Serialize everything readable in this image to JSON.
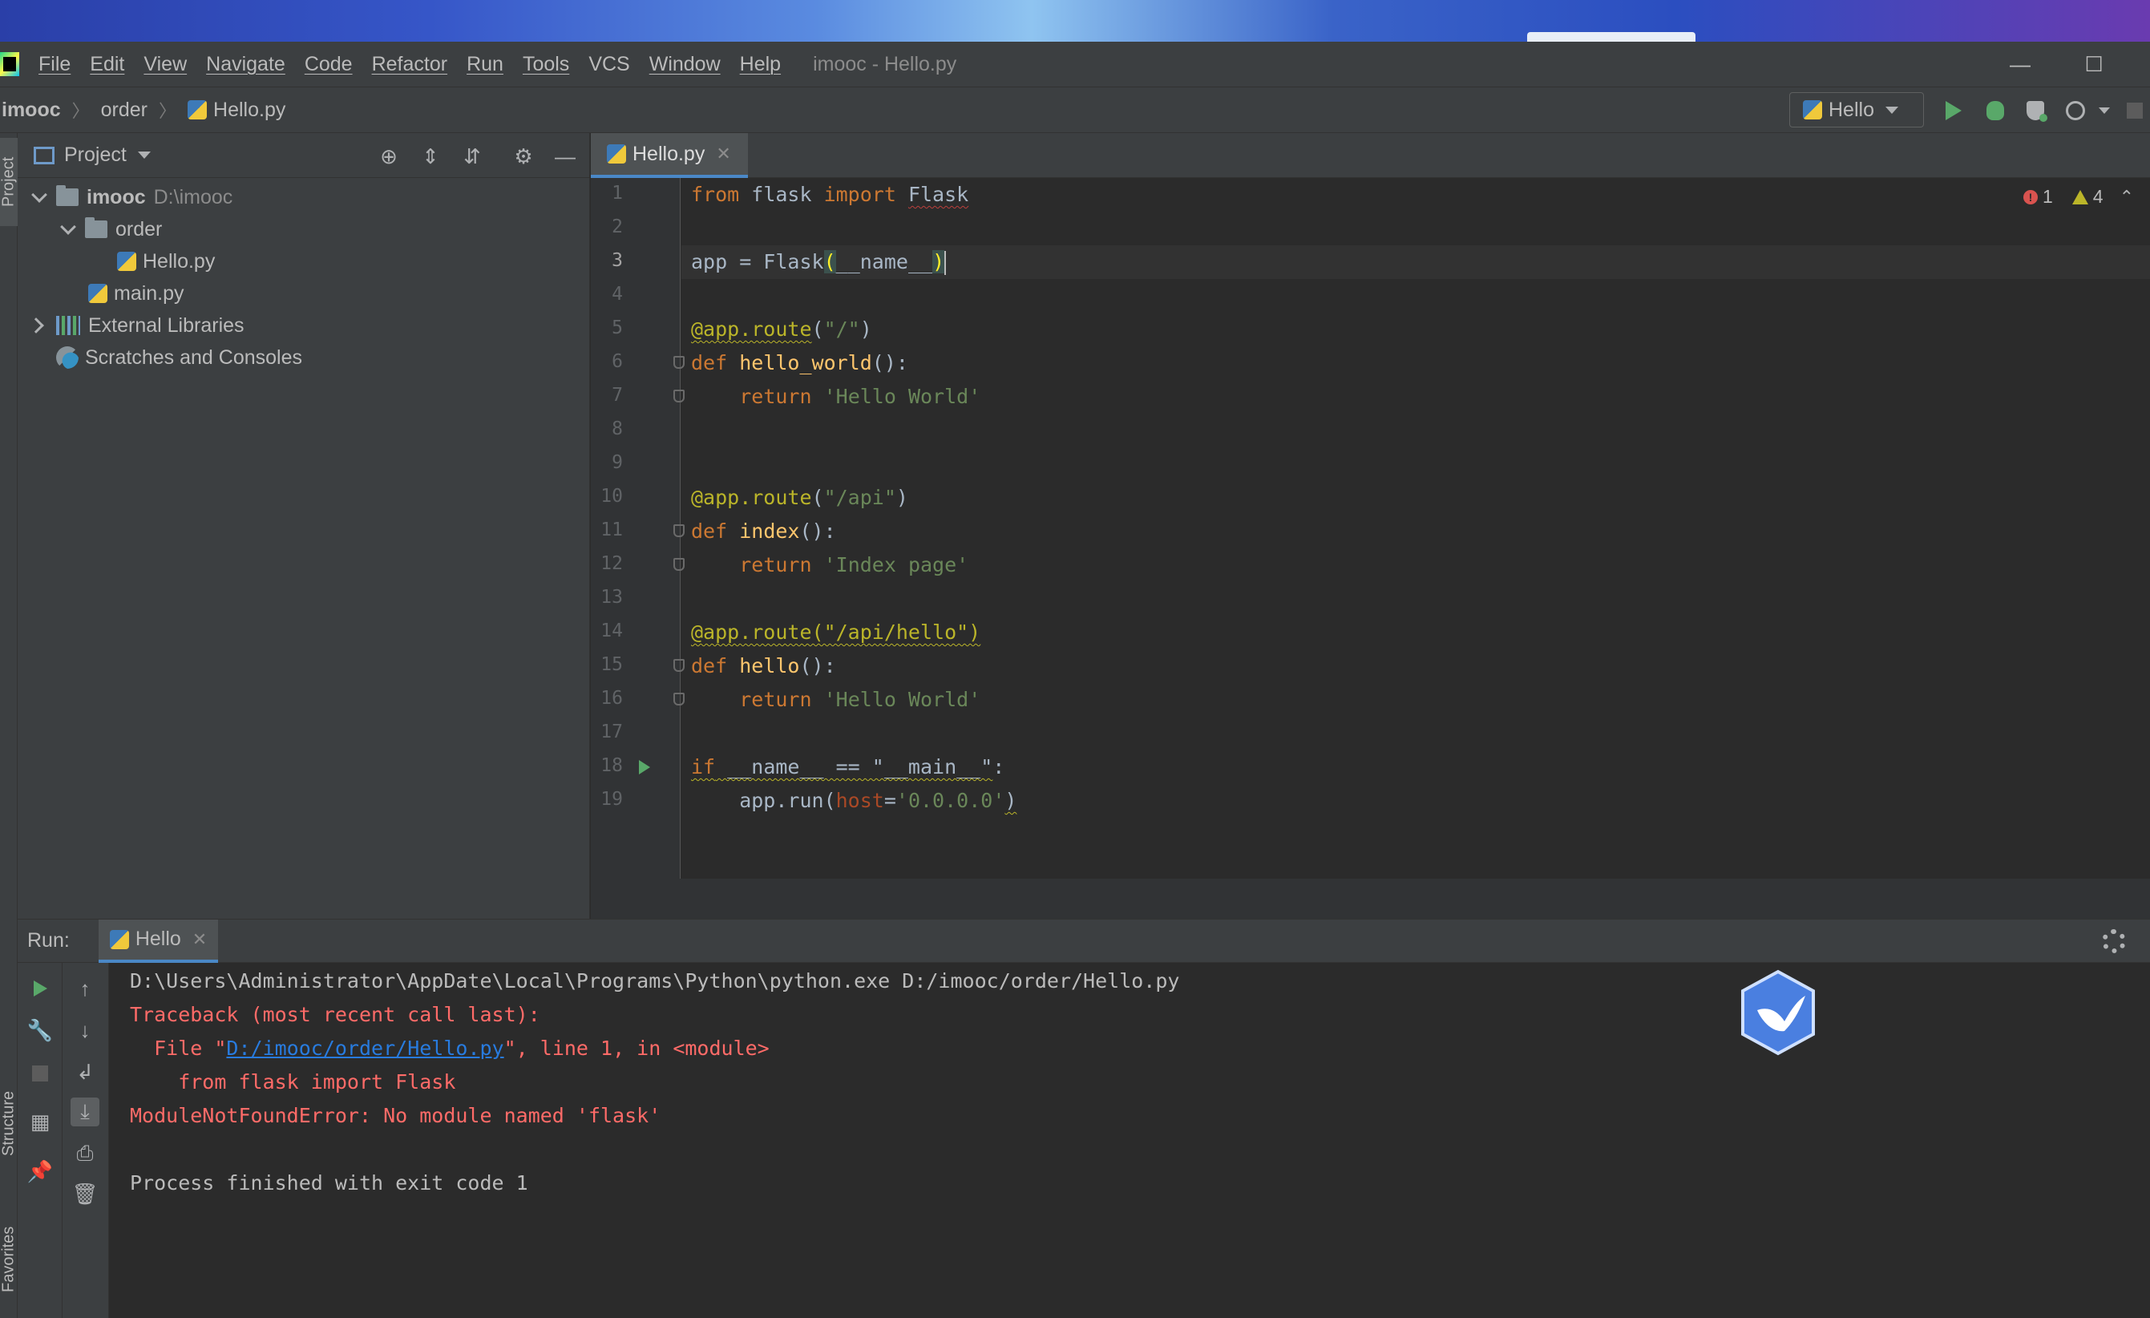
{
  "menu": {
    "items": [
      "File",
      "Edit",
      "View",
      "Navigate",
      "Code",
      "Refactor",
      "Run",
      "Tools",
      "VCS",
      "Window",
      "Help"
    ],
    "window_title": "imooc - Hello.py"
  },
  "navbar": {
    "crumbs": [
      "imooc",
      "order",
      "Hello.py"
    ],
    "run_config": "Hello"
  },
  "left_stripe": {
    "project_tab": "Project",
    "structure_tab": "Structure",
    "favorites_tab": "Favorites"
  },
  "project_panel": {
    "title": "Project",
    "tree": {
      "root_name": "imooc",
      "root_path": "D:\\imooc",
      "folder_order": "order",
      "file_hello": "Hello.py",
      "file_main": "main.py",
      "external_libraries": "External Libraries",
      "scratches": "Scratches and Consoles"
    }
  },
  "editor": {
    "tab_label": "Hello.py",
    "line_numbers": [
      "1",
      "2",
      "3",
      "4",
      "5",
      "6",
      "7",
      "8",
      "9",
      "10",
      "11",
      "12",
      "13",
      "14",
      "15",
      "16",
      "17",
      "18",
      "19"
    ],
    "current_line": 3,
    "inspections": {
      "errors": "1",
      "warnings": "4"
    },
    "code": {
      "l1_from": "from",
      "l1_mod": " flask ",
      "l1_import": "import",
      "l1_name": "Flask",
      "l3_a": "app = Flask",
      "l3_paren_open": "(",
      "l3_arg": "__name__",
      "l3_paren_close": ")",
      "l5_dec": "@app.route",
      "l5_open": "(",
      "l5_str": "\"/\"",
      "l5_close": ")",
      "l6_def": "def",
      "l6_fn": "hello_world",
      "l6_rest": "():",
      "l7_indent": "    ",
      "l7_return": "return",
      "l7_str": "'Hello World'",
      "l10_dec": "@app.route",
      "l10_open": "(",
      "l10_str": "\"/api\"",
      "l10_close": ")",
      "l11_def": "def",
      "l11_fn": "index",
      "l11_rest": "():",
      "l12_indent": "    ",
      "l12_return": "return",
      "l12_str": "'Index page'",
      "l14_dec": "@app.route(\"/api/hello\")",
      "l15_def": "def",
      "l15_fn": "hello",
      "l15_rest": "():",
      "l16_indent": "    ",
      "l16_return": "return",
      "l16_str": "'Hello World'",
      "l18_if": "if",
      "l18_rest": " __name__ == \"__main__\"",
      "l18_colon": ":",
      "l19_a": "    app.run(",
      "l19_param": "host",
      "l19_eq": "=",
      "l19_str": "'0.0.0.0'",
      "l19_close": ")"
    }
  },
  "run_panel": {
    "label": "Run:",
    "tab_label": "Hello",
    "console": {
      "cmd": "D:\\Users\\Administrator\\AppDate\\Local\\Programs\\Python\\python.exe D:/imooc/order/Hello.py",
      "traceback": "Traceback (most recent call last):",
      "file_prefix": "  File \"",
      "file_link": "D:/imooc/order/Hello.py",
      "file_suffix": "\", line 1, in <module>",
      "source_line": "    from flask import Flask",
      "error": "ModuleNotFoundError: No module named 'flask'",
      "blank": "",
      "exit": "Process finished with exit code 1"
    }
  },
  "colors": {
    "keyword": "#cc7832",
    "function": "#ffc66d",
    "string": "#6a8759",
    "decorator": "#bbb529",
    "error_text": "#ff6b68",
    "link": "#287bde",
    "accent": "#4a88c7",
    "run_green": "#59a869"
  },
  "icons": [
    "app-logo-icon",
    "python-file-icon",
    "run-icon",
    "debug-icon",
    "coverage-icon",
    "profile-icon",
    "stop-icon",
    "locate-icon",
    "expand-all-icon",
    "collapse-all-icon",
    "gear-icon",
    "minimize-icon",
    "folder-icon",
    "library-icon",
    "scratch-icon",
    "error-icon",
    "warning-icon",
    "rerun-icon",
    "wrench-icon",
    "up-arrow-icon",
    "down-arrow-icon",
    "soft-wrap-icon",
    "scroll-to-end-icon",
    "print-icon",
    "trash-icon",
    "layout-icon",
    "pin-icon",
    "bird-badge-icon"
  ]
}
